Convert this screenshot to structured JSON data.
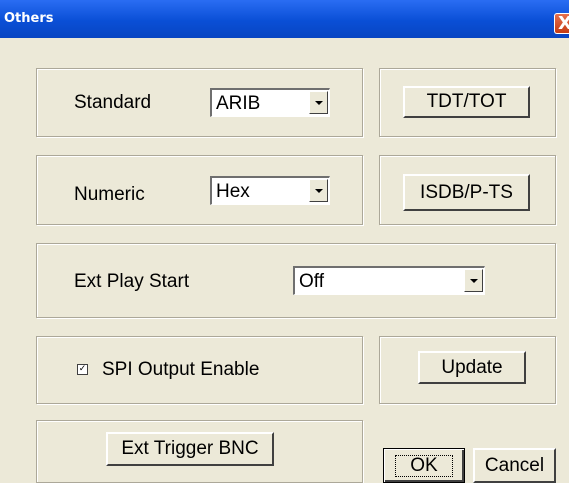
{
  "window": {
    "title": "Others",
    "close_glyph": "X"
  },
  "standard": {
    "label": "Standard",
    "value": "ARIB"
  },
  "numeric": {
    "label": "Numeric",
    "value": "Hex"
  },
  "ext_play_start": {
    "label": "Ext Play Start",
    "value": "Off"
  },
  "spi_output": {
    "label": "SPI Output Enable",
    "checked": true,
    "check_glyph": "✓"
  },
  "buttons": {
    "tdt_tot": "TDT/TOT",
    "isdb_pts": "ISDB/P-TS",
    "update": "Update",
    "ext_trigger": "Ext Trigger BNC",
    "ok": "OK",
    "cancel": "Cancel"
  },
  "icons": {
    "dropdown": "chevron-down-icon",
    "close": "close-icon",
    "checkbox": "checkbox-icon"
  }
}
